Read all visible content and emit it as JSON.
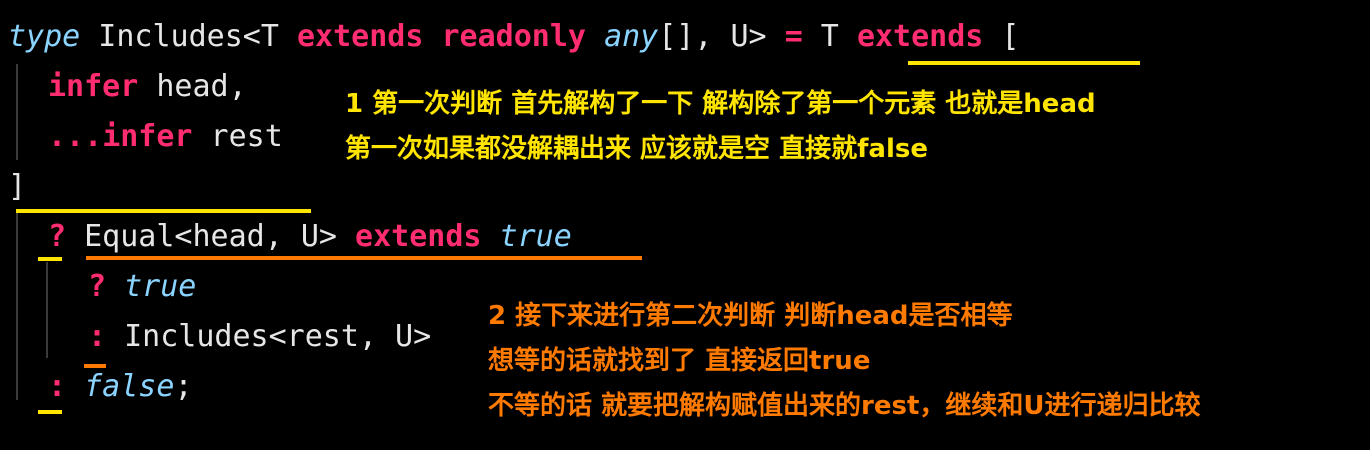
{
  "code": {
    "line1": {
      "kw_type": "type",
      "name": " Includes<T ",
      "kw_extends": "extends",
      "sp1": " ",
      "kw_readonly": "readonly",
      "sp2": " ",
      "ty_any": "any",
      "after_any": "[], U> ",
      "eq": "=",
      "t": " T ",
      "kw_extends2": "extends",
      "bracket": " ["
    },
    "line2": {
      "kw_infer": "infer",
      "rest": " head,"
    },
    "line3": {
      "spread": "...",
      "kw_infer": "infer",
      "rest": " rest"
    },
    "line4": {
      "close": "]"
    },
    "line5": {
      "q": "?",
      "mid": " Equal<head, U> ",
      "kw_extends": "extends",
      "sp": " ",
      "ty_true": "true"
    },
    "line6": {
      "q": "?",
      "sp": " ",
      "ty_true": "true"
    },
    "line7": {
      "colon": ":",
      "rest": " Includes<rest, U>"
    },
    "line8": {
      "colon": ":",
      "sp": " ",
      "ty_false": "false",
      "semi": ";"
    }
  },
  "annotations": {
    "yellow": [
      "1 第一次判断 首先解构了一下 解构除了第一个元素 也就是head",
      "第一次如果都没解耦出来 应该就是空 直接就false"
    ],
    "orange": [
      "2 接下来进行第二次判断 判断head是否相等",
      "想等的话就找到了 直接返回true",
      "不等的话 就要把解构赋值出来的rest，继续和U进行递归比较"
    ]
  },
  "colors": {
    "background": "#000000",
    "keyword": "#ff2d6f",
    "type": "#8ad4ff",
    "text": "#e6e6e6",
    "yellow_note": "#ffe500",
    "orange_note": "#ff7a00"
  }
}
